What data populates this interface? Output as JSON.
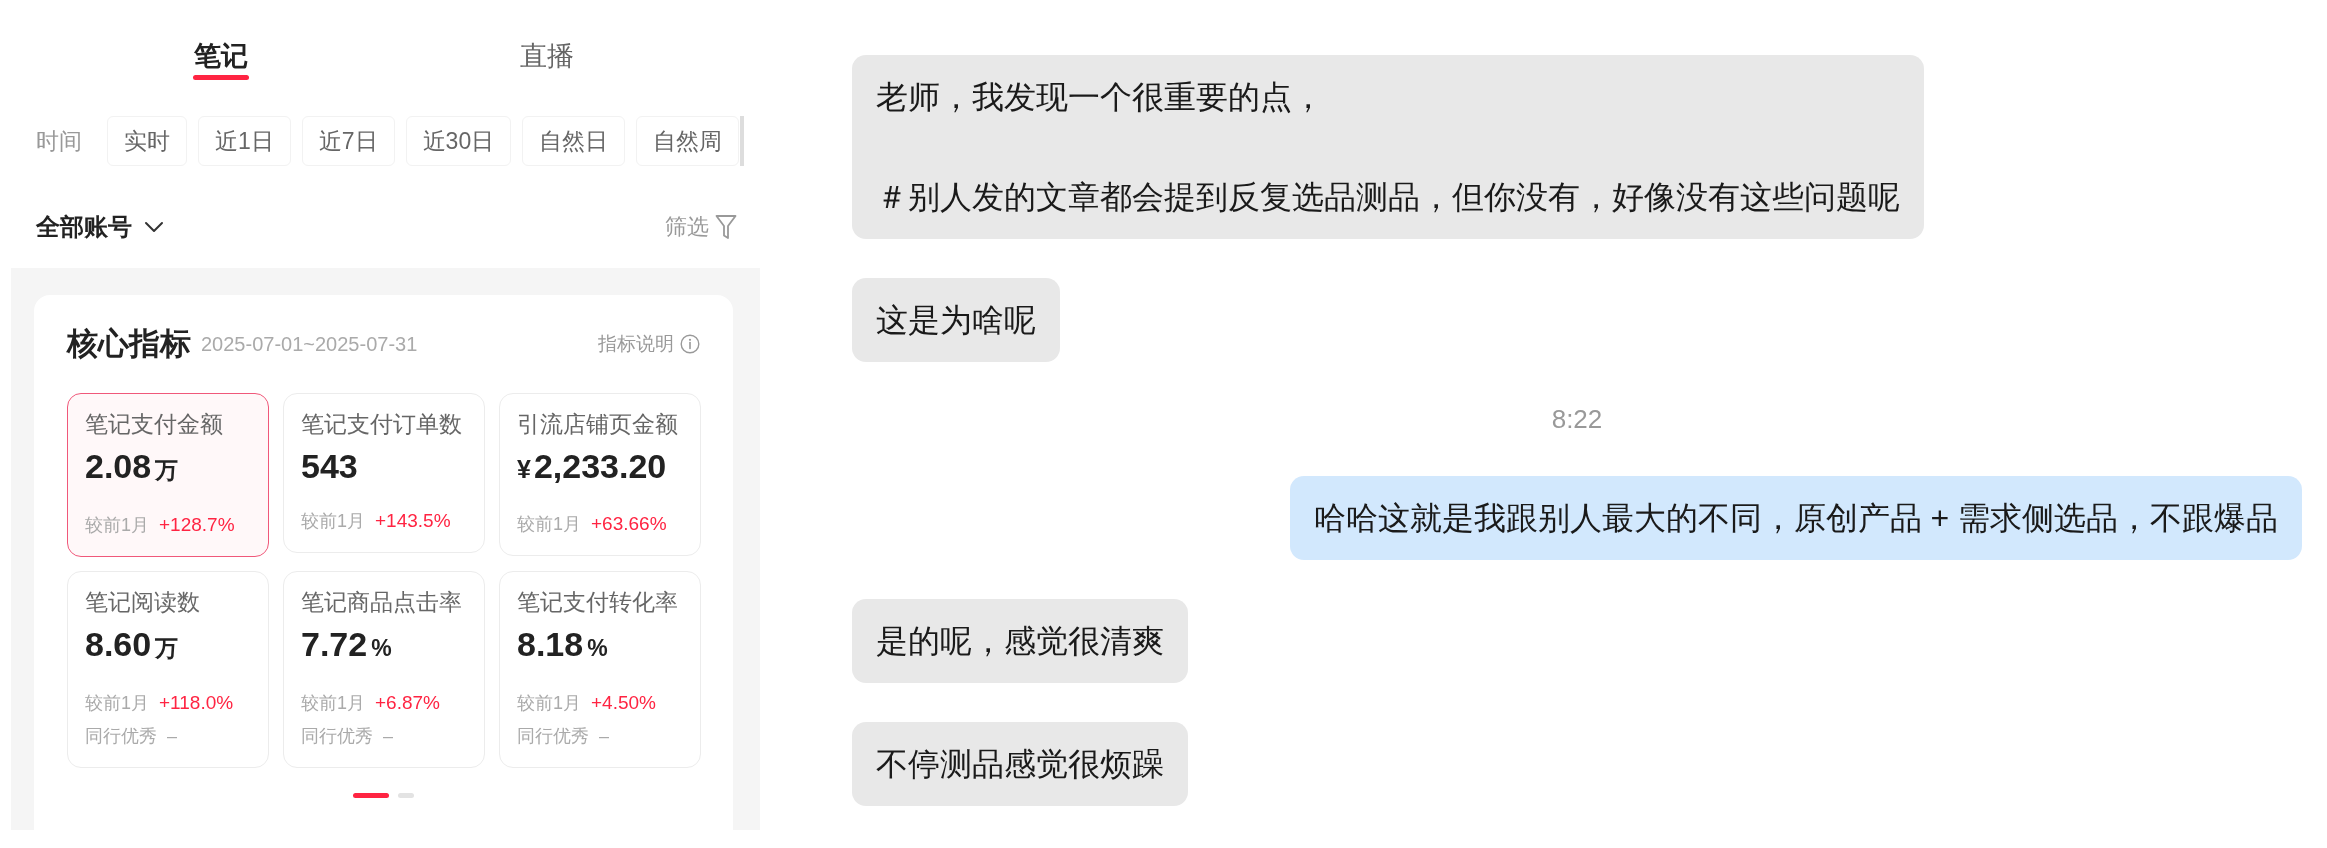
{
  "tabs": [
    {
      "label": "笔记",
      "selected": true
    },
    {
      "label": "直播",
      "selected": false
    }
  ],
  "time_filter": {
    "label": "时间",
    "options": [
      {
        "label": "实时",
        "selected": false
      },
      {
        "label": "近1日",
        "selected": false
      },
      {
        "label": "近7日",
        "selected": false
      },
      {
        "label": "近30日",
        "selected": false
      },
      {
        "label": "自然日",
        "selected": false
      },
      {
        "label": "自然周",
        "selected": false
      }
    ]
  },
  "account_selector": {
    "label": "全部账号"
  },
  "filter_button": {
    "label": "筛选"
  },
  "core_metrics": {
    "title": "核心指标",
    "date_range": "2025-07-01~2025-07-31",
    "help_link": "指标说明",
    "metrics": [
      {
        "label": "笔记支付金额",
        "value": "2.08",
        "unit": "万",
        "compare_label": "较前1月",
        "change": "+128.7%",
        "selected": true
      },
      {
        "label": "笔记支付订单数",
        "value": "543",
        "compare_label": "较前1月",
        "change": "+143.5%",
        "selected": false
      },
      {
        "label": "引流店铺页金额",
        "prefix": "¥",
        "value": "2,233.20",
        "compare_label": "较前1月",
        "change": "+63.66%",
        "selected": false
      },
      {
        "label": "笔记阅读数",
        "value": "8.60",
        "unit": "万",
        "compare_label": "较前1月",
        "change": "+118.0%",
        "peer_label": "同行优秀",
        "peer_value": "–",
        "selected": false
      },
      {
        "label": "笔记商品点击率",
        "value": "7.72",
        "unit": "%",
        "compare_label": "较前1月",
        "change": "+6.87%",
        "peer_label": "同行优秀",
        "peer_value": "–",
        "selected": false
      },
      {
        "label": "笔记支付转化率",
        "value": "8.18",
        "unit": "%",
        "compare_label": "较前1月",
        "change": "+4.50%",
        "peer_label": "同行优秀",
        "peer_value": "–",
        "selected": false
      }
    ],
    "pages": [
      {
        "selected": true
      },
      {
        "selected": false
      }
    ]
  },
  "chat": {
    "messages": [
      {
        "kind": "received",
        "paragraphs": [
          "老师，我发现一个很重要的点，",
          "＃别人发的文章都会提到反复选品测品，但你没有，好像没有这些问题呢"
        ]
      },
      {
        "kind": "received",
        "paragraphs": [
          "这是为啥呢"
        ]
      },
      {
        "kind": "time",
        "text": "8:22"
      },
      {
        "kind": "sent",
        "paragraphs": [
          "哈哈这就是我跟别人最大的不同，原创产品 + 需求侧选品，不跟爆品"
        ]
      },
      {
        "kind": "received",
        "paragraphs": [
          "是的呢，感觉很清爽"
        ]
      },
      {
        "kind": "received",
        "paragraphs": [
          "不停测品感觉很烦躁"
        ]
      }
    ]
  }
}
